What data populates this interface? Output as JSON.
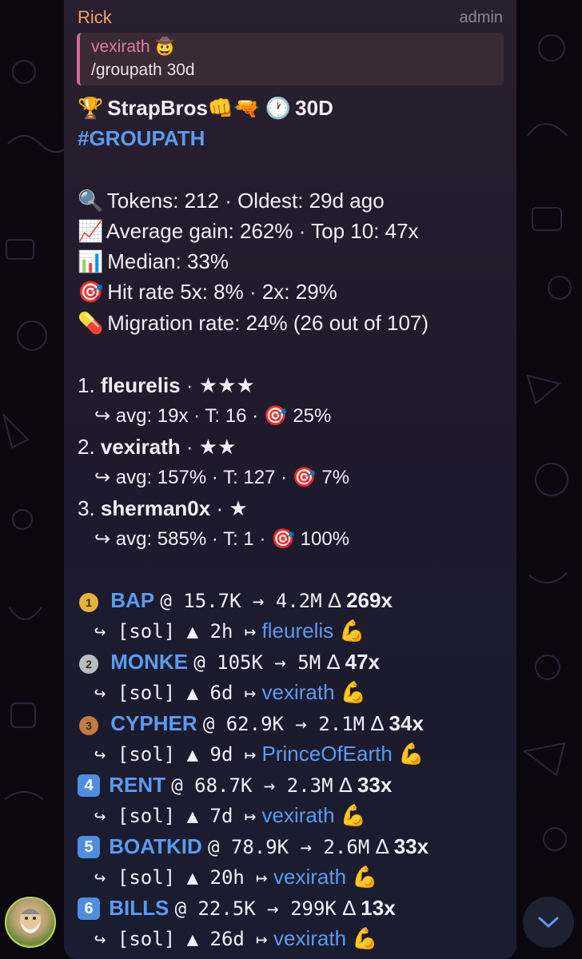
{
  "message": {
    "sender": "Rick",
    "role": "admin",
    "reply": {
      "name": "vexirath 🤠",
      "text": "/groupath 30d"
    },
    "header": {
      "trophy": "🏆",
      "title": "StrapBros👊🔫",
      "clock": "🕐",
      "period": "30D"
    },
    "hashtag": "#GROUPATH",
    "stats": [
      {
        "icon": "🔍",
        "text": "Tokens: 212 · Oldest: 29d ago"
      },
      {
        "icon": "📈",
        "text": "Average gain: 262% · Top 10: 47x"
      },
      {
        "icon": "📊",
        "text": "Median: 33%"
      },
      {
        "icon": "🎯",
        "text": "Hit rate 5x: 8% · 2x: 29%"
      },
      {
        "icon": "💊",
        "text": "Migration rate: 24% (26 out of 107)"
      }
    ],
    "callers": [
      {
        "rank": "1.",
        "name": "fleurelis",
        "stars": "· ★★★",
        "detail": "↪ avg: 19x · T: 16 · 🎯 25%"
      },
      {
        "rank": "2.",
        "name": "vexirath",
        "stars": "· ★★",
        "detail": "↪ avg: 157% · T: 127 · 🎯 7%"
      },
      {
        "rank": "3.",
        "name": "sherman0x",
        "stars": "· ★",
        "detail": "↪ avg: 585% · T: 1 · 🎯 100%"
      }
    ],
    "tokens": [
      {
        "badge": "1",
        "badge_color": "#e8b23a",
        "symbol": "BAP",
        "entry": "@ 15.7K → 4.2M",
        "delta": "Δ",
        "mult": "269x",
        "sub": "↪ [sol] ▲ 2h ↦",
        "caller": "fleurelis",
        "flex": "💪"
      },
      {
        "badge": "2",
        "badge_color": "#b9bcc2",
        "symbol": "MONKE",
        "entry": " @ 105K → 5M",
        "delta": "Δ",
        "mult": "47x",
        "sub": "↪ [sol] ▲ 6d ↦",
        "caller": "vexirath",
        "flex": "💪"
      },
      {
        "badge": "3",
        "badge_color": "#c27a45",
        "symbol": "CYPHER",
        "entry": "@ 62.9K → 2.1M",
        "delta": "Δ",
        "mult": "34x",
        "sub": "↪ [sol] ▲ 9d ↦",
        "caller": "PrinceOfEarth",
        "flex": "💪"
      },
      {
        "badge": "4",
        "badge_color": "#4f8de0",
        "symbol": "RENT",
        "entry": "@ 68.7K → 2.3M",
        "delta": "Δ",
        "mult": "33x",
        "sub": "↪ [sol] ▲ 7d ↦",
        "caller": "vexirath",
        "flex": "💪"
      },
      {
        "badge": "5",
        "badge_color": "#4f8de0",
        "symbol": "BOATKID",
        "entry": "@ 78.9K → 2.6M",
        "delta": "Δ",
        "mult": "33x",
        "sub": "↪ [sol] ▲ 20h ↦",
        "caller": "vexirath",
        "flex": "💪"
      },
      {
        "badge": "6",
        "badge_color": "#4f8de0",
        "symbol": "BILLS",
        "entry": "@ 22.5K → 299K",
        "delta": "Δ",
        "mult": "13x",
        "sub": "↪ [sol] ▲ 26d ↦",
        "caller": "vexirath",
        "flex": "💪"
      }
    ]
  },
  "colors": {
    "sender": "#f0a06a",
    "reply_accent": "#d8689a",
    "link": "#5b9bf0",
    "bubble": "#221c2e",
    "background": "#0b0710"
  },
  "icons": {
    "avatar": "bearded-man-avatar",
    "scroll": "chevron-down-icon"
  }
}
